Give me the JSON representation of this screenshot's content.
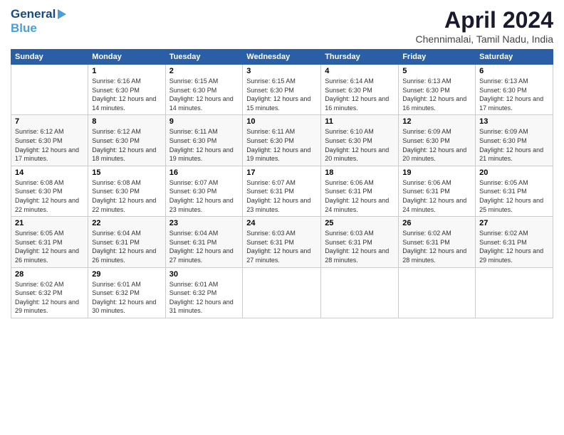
{
  "logo": {
    "general": "General",
    "blue": "Blue"
  },
  "title": "April 2024",
  "subtitle": "Chennimalai, Tamil Nadu, India",
  "days_of_week": [
    "Sunday",
    "Monday",
    "Tuesday",
    "Wednesday",
    "Thursday",
    "Friday",
    "Saturday"
  ],
  "weeks": [
    [
      {
        "num": "",
        "sunrise": "",
        "sunset": "",
        "daylight": ""
      },
      {
        "num": "1",
        "sunrise": "Sunrise: 6:16 AM",
        "sunset": "Sunset: 6:30 PM",
        "daylight": "Daylight: 12 hours and 14 minutes."
      },
      {
        "num": "2",
        "sunrise": "Sunrise: 6:15 AM",
        "sunset": "Sunset: 6:30 PM",
        "daylight": "Daylight: 12 hours and 14 minutes."
      },
      {
        "num": "3",
        "sunrise": "Sunrise: 6:15 AM",
        "sunset": "Sunset: 6:30 PM",
        "daylight": "Daylight: 12 hours and 15 minutes."
      },
      {
        "num": "4",
        "sunrise": "Sunrise: 6:14 AM",
        "sunset": "Sunset: 6:30 PM",
        "daylight": "Daylight: 12 hours and 16 minutes."
      },
      {
        "num": "5",
        "sunrise": "Sunrise: 6:13 AM",
        "sunset": "Sunset: 6:30 PM",
        "daylight": "Daylight: 12 hours and 16 minutes."
      },
      {
        "num": "6",
        "sunrise": "Sunrise: 6:13 AM",
        "sunset": "Sunset: 6:30 PM",
        "daylight": "Daylight: 12 hours and 17 minutes."
      }
    ],
    [
      {
        "num": "7",
        "sunrise": "Sunrise: 6:12 AM",
        "sunset": "Sunset: 6:30 PM",
        "daylight": "Daylight: 12 hours and 17 minutes."
      },
      {
        "num": "8",
        "sunrise": "Sunrise: 6:12 AM",
        "sunset": "Sunset: 6:30 PM",
        "daylight": "Daylight: 12 hours and 18 minutes."
      },
      {
        "num": "9",
        "sunrise": "Sunrise: 6:11 AM",
        "sunset": "Sunset: 6:30 PM",
        "daylight": "Daylight: 12 hours and 19 minutes."
      },
      {
        "num": "10",
        "sunrise": "Sunrise: 6:11 AM",
        "sunset": "Sunset: 6:30 PM",
        "daylight": "Daylight: 12 hours and 19 minutes."
      },
      {
        "num": "11",
        "sunrise": "Sunrise: 6:10 AM",
        "sunset": "Sunset: 6:30 PM",
        "daylight": "Daylight: 12 hours and 20 minutes."
      },
      {
        "num": "12",
        "sunrise": "Sunrise: 6:09 AM",
        "sunset": "Sunset: 6:30 PM",
        "daylight": "Daylight: 12 hours and 20 minutes."
      },
      {
        "num": "13",
        "sunrise": "Sunrise: 6:09 AM",
        "sunset": "Sunset: 6:30 PM",
        "daylight": "Daylight: 12 hours and 21 minutes."
      }
    ],
    [
      {
        "num": "14",
        "sunrise": "Sunrise: 6:08 AM",
        "sunset": "Sunset: 6:30 PM",
        "daylight": "Daylight: 12 hours and 22 minutes."
      },
      {
        "num": "15",
        "sunrise": "Sunrise: 6:08 AM",
        "sunset": "Sunset: 6:30 PM",
        "daylight": "Daylight: 12 hours and 22 minutes."
      },
      {
        "num": "16",
        "sunrise": "Sunrise: 6:07 AM",
        "sunset": "Sunset: 6:30 PM",
        "daylight": "Daylight: 12 hours and 23 minutes."
      },
      {
        "num": "17",
        "sunrise": "Sunrise: 6:07 AM",
        "sunset": "Sunset: 6:31 PM",
        "daylight": "Daylight: 12 hours and 23 minutes."
      },
      {
        "num": "18",
        "sunrise": "Sunrise: 6:06 AM",
        "sunset": "Sunset: 6:31 PM",
        "daylight": "Daylight: 12 hours and 24 minutes."
      },
      {
        "num": "19",
        "sunrise": "Sunrise: 6:06 AM",
        "sunset": "Sunset: 6:31 PM",
        "daylight": "Daylight: 12 hours and 24 minutes."
      },
      {
        "num": "20",
        "sunrise": "Sunrise: 6:05 AM",
        "sunset": "Sunset: 6:31 PM",
        "daylight": "Daylight: 12 hours and 25 minutes."
      }
    ],
    [
      {
        "num": "21",
        "sunrise": "Sunrise: 6:05 AM",
        "sunset": "Sunset: 6:31 PM",
        "daylight": "Daylight: 12 hours and 26 minutes."
      },
      {
        "num": "22",
        "sunrise": "Sunrise: 6:04 AM",
        "sunset": "Sunset: 6:31 PM",
        "daylight": "Daylight: 12 hours and 26 minutes."
      },
      {
        "num": "23",
        "sunrise": "Sunrise: 6:04 AM",
        "sunset": "Sunset: 6:31 PM",
        "daylight": "Daylight: 12 hours and 27 minutes."
      },
      {
        "num": "24",
        "sunrise": "Sunrise: 6:03 AM",
        "sunset": "Sunset: 6:31 PM",
        "daylight": "Daylight: 12 hours and 27 minutes."
      },
      {
        "num": "25",
        "sunrise": "Sunrise: 6:03 AM",
        "sunset": "Sunset: 6:31 PM",
        "daylight": "Daylight: 12 hours and 28 minutes."
      },
      {
        "num": "26",
        "sunrise": "Sunrise: 6:02 AM",
        "sunset": "Sunset: 6:31 PM",
        "daylight": "Daylight: 12 hours and 28 minutes."
      },
      {
        "num": "27",
        "sunrise": "Sunrise: 6:02 AM",
        "sunset": "Sunset: 6:31 PM",
        "daylight": "Daylight: 12 hours and 29 minutes."
      }
    ],
    [
      {
        "num": "28",
        "sunrise": "Sunrise: 6:02 AM",
        "sunset": "Sunset: 6:32 PM",
        "daylight": "Daylight: 12 hours and 29 minutes."
      },
      {
        "num": "29",
        "sunrise": "Sunrise: 6:01 AM",
        "sunset": "Sunset: 6:32 PM",
        "daylight": "Daylight: 12 hours and 30 minutes."
      },
      {
        "num": "30",
        "sunrise": "Sunrise: 6:01 AM",
        "sunset": "Sunset: 6:32 PM",
        "daylight": "Daylight: 12 hours and 31 minutes."
      },
      {
        "num": "",
        "sunrise": "",
        "sunset": "",
        "daylight": ""
      },
      {
        "num": "",
        "sunrise": "",
        "sunset": "",
        "daylight": ""
      },
      {
        "num": "",
        "sunrise": "",
        "sunset": "",
        "daylight": ""
      },
      {
        "num": "",
        "sunrise": "",
        "sunset": "",
        "daylight": ""
      }
    ]
  ]
}
